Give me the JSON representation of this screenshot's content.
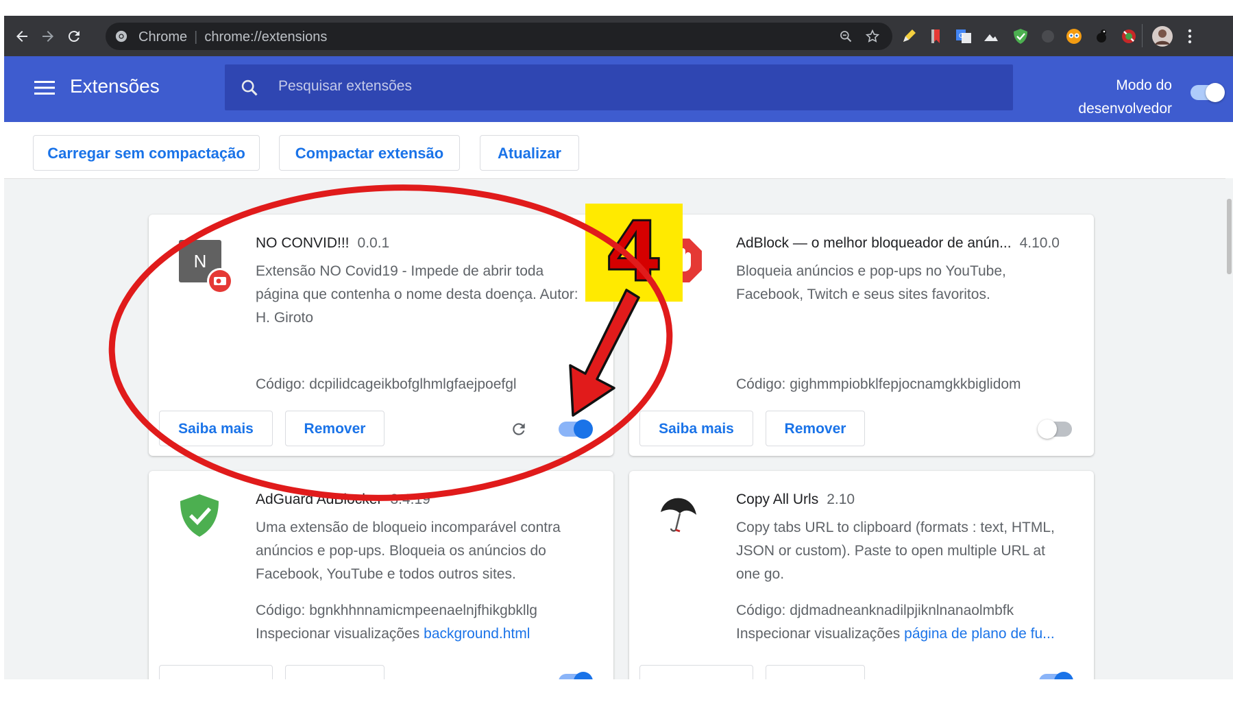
{
  "browser": {
    "brand": "Chrome",
    "url": "chrome://extensions"
  },
  "header": {
    "title": "Extensões",
    "search_placeholder": "Pesquisar extensões",
    "dev_mode_line1": "Modo do",
    "dev_mode_line2": "desenvolvedor",
    "dev_mode_on": true
  },
  "actions": {
    "load_unpacked": "Carregar sem compactação",
    "pack": "Compactar extensão",
    "update": "Atualizar"
  },
  "extensions": [
    {
      "name": "NO CONVID!!!",
      "version": "0.0.1",
      "description": "Extensão NO Covid19 - Impede de abrir toda página que contenha o nome desta doença. Autor: H. Giroto",
      "icon_letter": "N",
      "code_label": "Código: dcpilidcageikbofglhmlgfaejpoefgl",
      "details": "Saiba mais",
      "remove": "Remover",
      "enabled": true
    },
    {
      "name": "AdBlock — o melhor bloqueador de anún...",
      "version": "4.10.0",
      "description": "Bloqueia anúncios e pop-ups no YouTube, Facebook, Twitch e seus sites favoritos.",
      "code_label": "Código: gighmmpiobklfepjocnamgkkbiglidom",
      "details": "Saiba mais",
      "remove": "Remover",
      "enabled": false
    },
    {
      "name": "AdGuard AdBlocker",
      "version": "3.4.19",
      "description": "Uma extensão de bloqueio incomparável contra anúncios e pop-ups. Bloqueia os anúncios do Facebook, YouTube e todos outros sites.",
      "code_label": "Código: bgnkhhnnamicmpeenaelnjfhikgbkllg",
      "inspect_label": "Inspecionar visualizações",
      "inspect_link": "background.html",
      "enabled": true
    },
    {
      "name": "Copy All Urls",
      "version": "2.10",
      "description": "Copy tabs URL to clipboard (formats : text, HTML, JSON or custom). Paste to open multiple URL at one go.",
      "code_label": "Código: djdmadneanknadilpjiknlnanaolmbfk",
      "inspect_label": "Inspecionar visualizações",
      "inspect_link": "página de plano de fu...",
      "enabled": true
    }
  ],
  "annotation": {
    "step_number": "4",
    "circle_color": "#e01b1b",
    "box_color": "#ffea00"
  },
  "colors": {
    "header_bg": "#3e5ccf",
    "search_bg": "#2f46b2",
    "accent": "#1a73e8",
    "toolbar_bg": "#35363a"
  }
}
